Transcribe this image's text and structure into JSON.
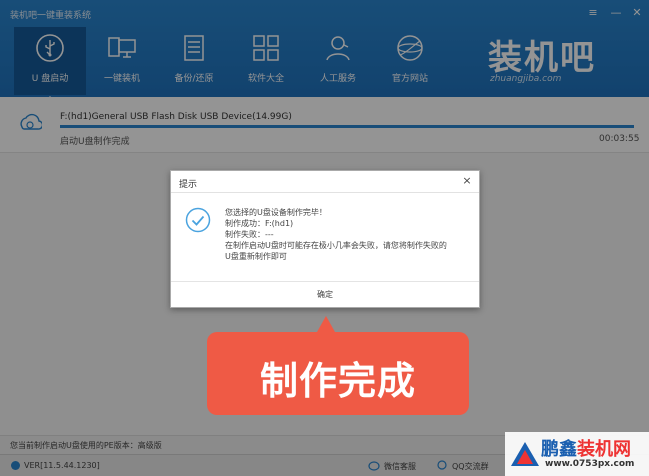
{
  "app": {
    "title": "装机吧一键重装系统",
    "window_controls": [
      "≡",
      "—",
      "✕"
    ]
  },
  "nav": {
    "items": [
      {
        "label": "U 盘启动",
        "icon": "usb-icon",
        "active": true
      },
      {
        "label": "一键装机",
        "icon": "monitor-icon",
        "active": false
      },
      {
        "label": "备份/还原",
        "icon": "backup-icon",
        "active": false
      },
      {
        "label": "软件大全",
        "icon": "apps-grid-icon",
        "active": false
      },
      {
        "label": "人工服务",
        "icon": "support-agent-icon",
        "active": false
      },
      {
        "label": "官方网站",
        "icon": "globe-icon",
        "active": false
      }
    ]
  },
  "brand": {
    "logo_text": "装机吧",
    "url": "zhuangjiba.com"
  },
  "device": {
    "name": "F:(hd1)General USB Flash Disk USB Device(14.99G)",
    "status": "启动U盘制作完成",
    "elapsed": "00:03:55",
    "progress": 1.0
  },
  "dialog": {
    "title": "提示",
    "close": "×",
    "lines": [
      "您选择的U盘设备制作完毕！",
      "制作成功：F:(hd1)",
      "制作失败：---",
      "在制作启动U盘时可能存在极小几率会失败，请您将制作失败的",
      "U盘重新制作即可"
    ],
    "ok_label": "确定"
  },
  "callout": {
    "text": "制作完成"
  },
  "bottom": {
    "pe_text": "您当前制作启动U盘使用的PE版本：高级版",
    "version": "VER[11.5.44.1230]",
    "wechat": "微信客服",
    "qq": "QQ交流群"
  },
  "watermark": {
    "main_blue": "鹏鑫",
    "main_red": "装机网",
    "url": "www.0753px.com"
  },
  "colors": {
    "header": "#1f72bd",
    "accent": "#2a86cf",
    "callout": "#ef5a45"
  }
}
